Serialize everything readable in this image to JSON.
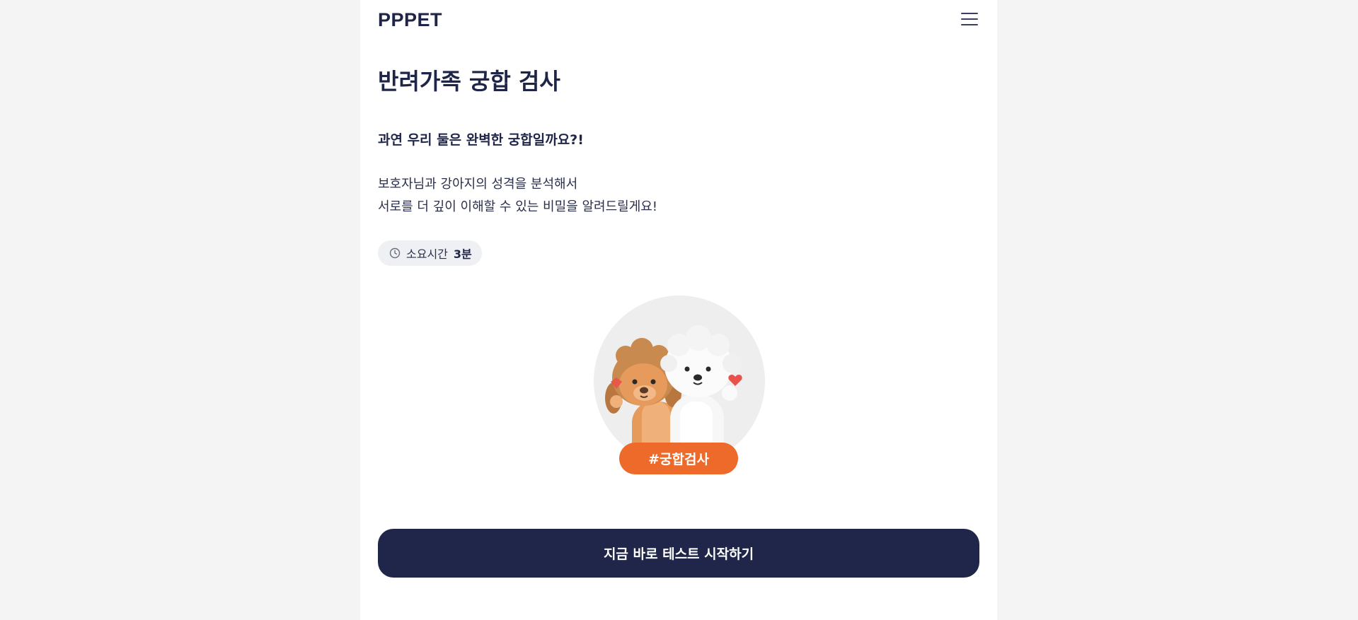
{
  "header": {
    "logo": "PPPET",
    "menu_icon": "hamburger-menu-icon"
  },
  "main": {
    "title": "반려가족 궁합 검사",
    "subtitle": "과연 우리 둘은 완벽한 궁합일까요?!",
    "description_lines": [
      "보호자님과 강아지의 성격을 분석해서",
      "서로를 더 깊이 이해할 수 있는 비밀을 알려드릴게요!"
    ],
    "duration": {
      "icon": "clock-icon",
      "label": "소요시간",
      "value": "3분"
    },
    "hero_image": "two-puppy-figures",
    "tag": "#궁합검사",
    "start_button": "지금 바로 테스트 시작하기"
  },
  "colors": {
    "navy": "#20254a",
    "accent_orange": "#ee6a2a",
    "background": "#f4f4f5",
    "chip_background": "#eef0f4"
  }
}
